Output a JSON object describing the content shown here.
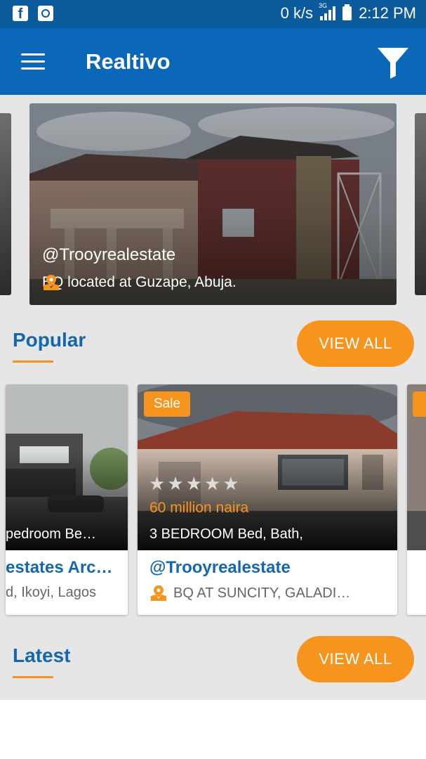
{
  "status_bar": {
    "speed": "0 k/s",
    "network": "3G",
    "time": "2:12 PM",
    "icons": [
      "facebook-icon",
      "instagram-icon",
      "signal-icon",
      "battery-icon"
    ]
  },
  "app_bar": {
    "title": "Realtivo",
    "menu_icon": "menu-icon",
    "filter_icon": "filter-icon",
    "color": "#0b67b7"
  },
  "featured": {
    "author": "@Trooyrealestate",
    "location": "BQ located at Guzape, Abuja."
  },
  "sections": {
    "popular": {
      "title": "Popular",
      "view_all": "VIEW ALL"
    },
    "latest": {
      "title": "Latest",
      "view_all": "VIEW ALL"
    }
  },
  "popular_cards": [
    {
      "beds": "pedroom  Be…",
      "author": "estates Arc…",
      "location": "d, Ikoyi, Lagos"
    },
    {
      "badge": "Sale",
      "rating": 0,
      "rating_max": 5,
      "price": "60 million naira",
      "beds": "3 BEDROOM Bed,  Bath,",
      "author": "@Trooyrealestate",
      "location": "BQ AT SUNCITY, GALADI…"
    }
  ],
  "colors": {
    "accent": "#f7941d",
    "primary": "#1466ad",
    "background": "#e6e6e6"
  }
}
